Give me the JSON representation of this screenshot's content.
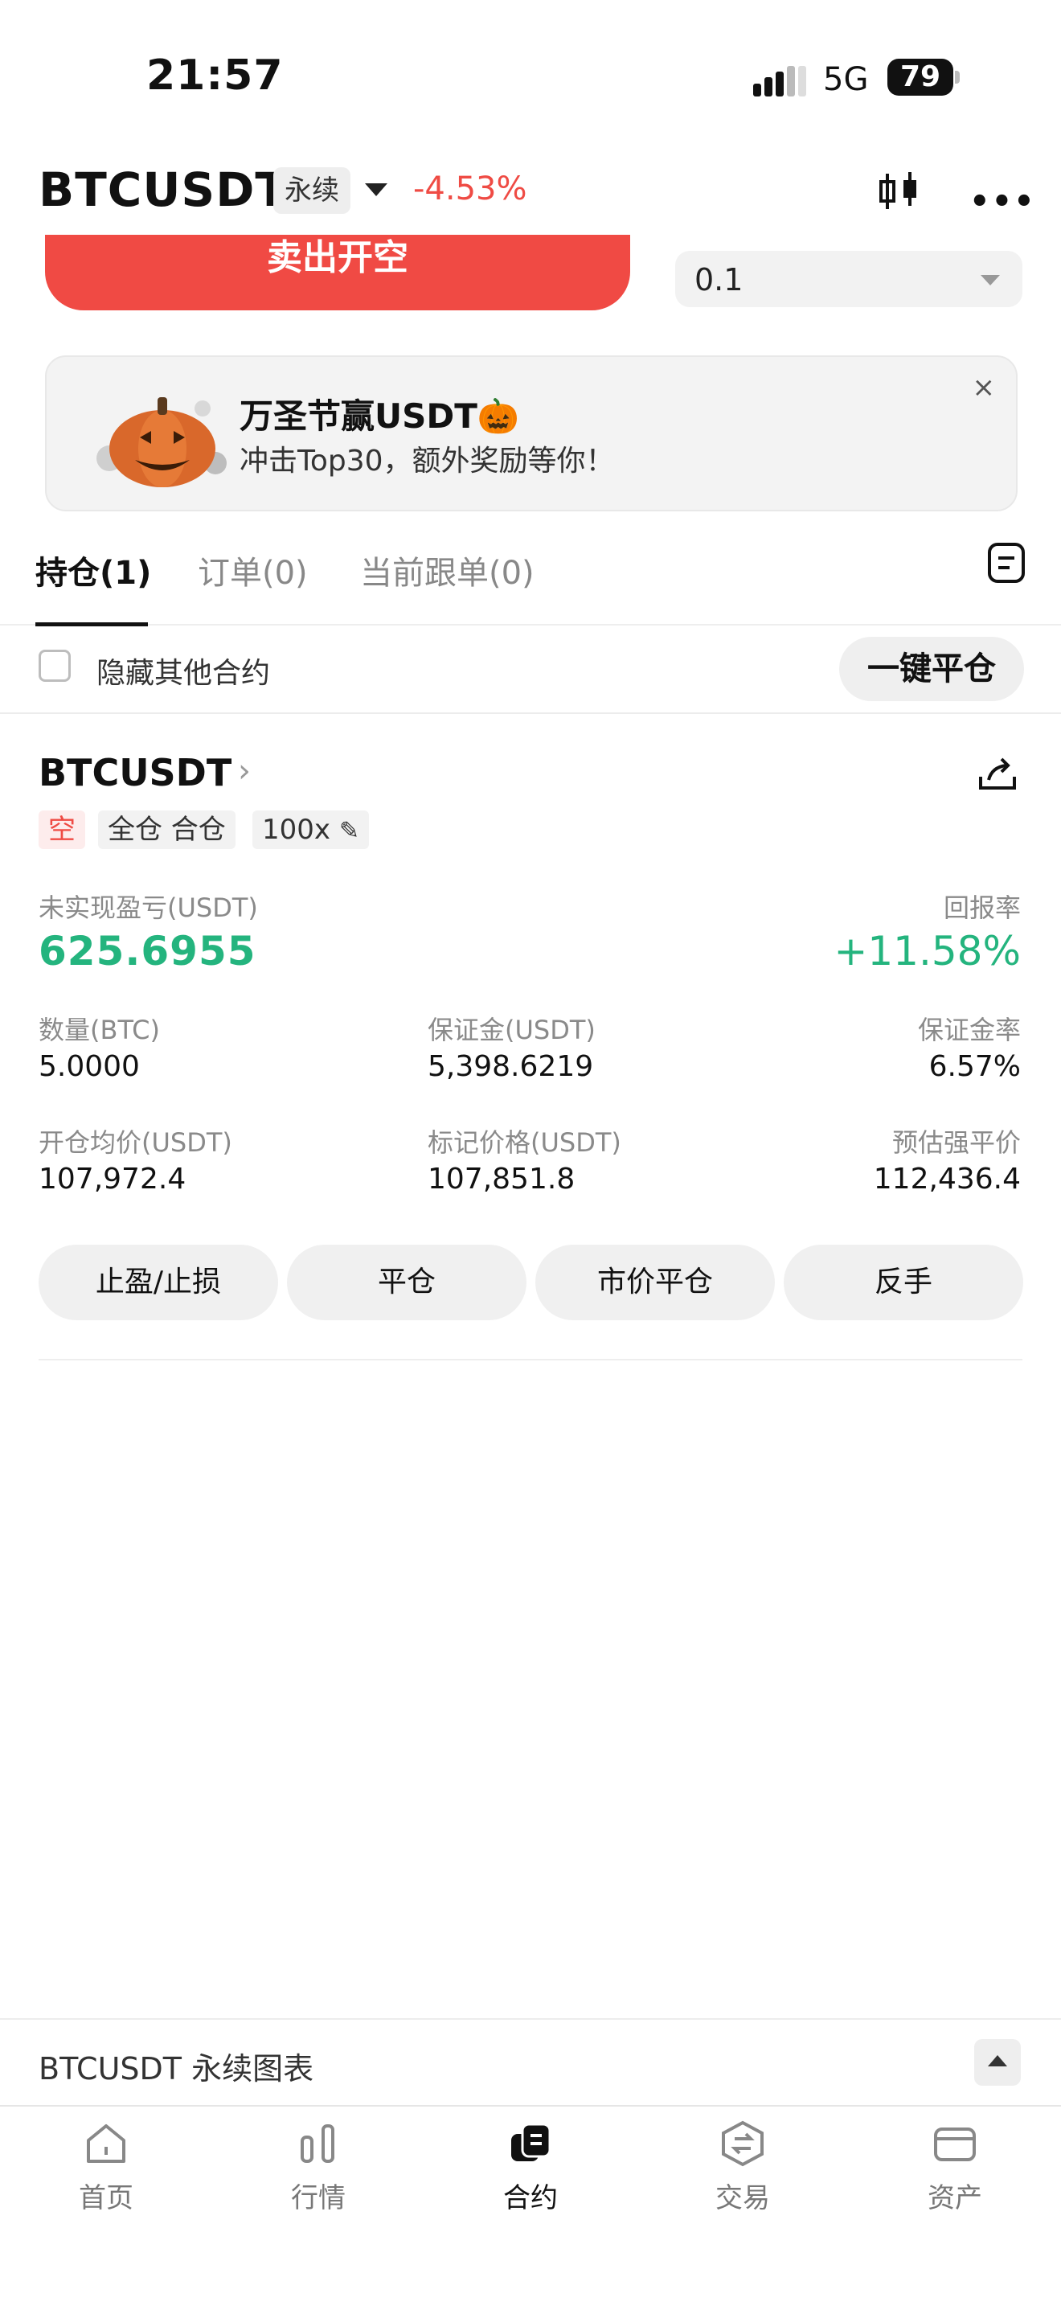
{
  "status_bar": {
    "time": "21:57",
    "network": "5G",
    "battery": "79"
  },
  "header": {
    "symbol": "BTCUSDT",
    "contract_type": "永续",
    "change": "-4.53%"
  },
  "order_panel": {
    "sell_label": "卖出开空",
    "quantity": "0.1"
  },
  "banner": {
    "title": "万圣节赢USDT🎃",
    "subtitle": "冲击Top30，额外奖励等你！",
    "close": "×"
  },
  "tabs": [
    {
      "label": "持仓(1)",
      "active": true
    },
    {
      "label": "订单(0)",
      "active": false
    },
    {
      "label": "当前跟单(0)",
      "active": false
    }
  ],
  "filter": {
    "hide_label": "隐藏其他合约",
    "close_all": "一键平仓"
  },
  "position": {
    "symbol": "BTCUSDT",
    "chevron": "›",
    "tags": {
      "side": "空",
      "margin_mode": "全仓 合仓",
      "leverage": "100x"
    },
    "pnl_label": "未实现盈亏(USDT)",
    "pnl_value": "625.6955",
    "roe_label": "回报率",
    "roe_value": "+11.58%",
    "qty_label": "数量(BTC)",
    "qty_value": "5.0000",
    "margin_label": "保证金(USDT)",
    "margin_value": "5,398.6219",
    "margin_ratio_label": "保证金率",
    "margin_ratio_value": "6.57%",
    "entry_label": "开仓均价(USDT)",
    "entry_value": "107,972.4",
    "mark_label": "标记价格(USDT)",
    "mark_value": "107,851.8",
    "liq_label": "预估强平价",
    "liq_value": "112,436.4",
    "actions": [
      "止盈/止损",
      "平仓",
      "市价平仓",
      "反手"
    ]
  },
  "chart_bar": {
    "label": "BTCUSDT 永续图表"
  },
  "nav": [
    {
      "label": "首页",
      "icon": "home-icon",
      "active": false
    },
    {
      "label": "行情",
      "icon": "market-icon",
      "active": false
    },
    {
      "label": "合约",
      "icon": "futures-icon",
      "active": true
    },
    {
      "label": "交易",
      "icon": "trade-icon",
      "active": false
    },
    {
      "label": "资产",
      "icon": "wallet-icon",
      "active": false
    }
  ],
  "colors": {
    "sell_red": "#f04a44",
    "profit_green": "#24b47e",
    "loss_red": "#ef4b44"
  }
}
